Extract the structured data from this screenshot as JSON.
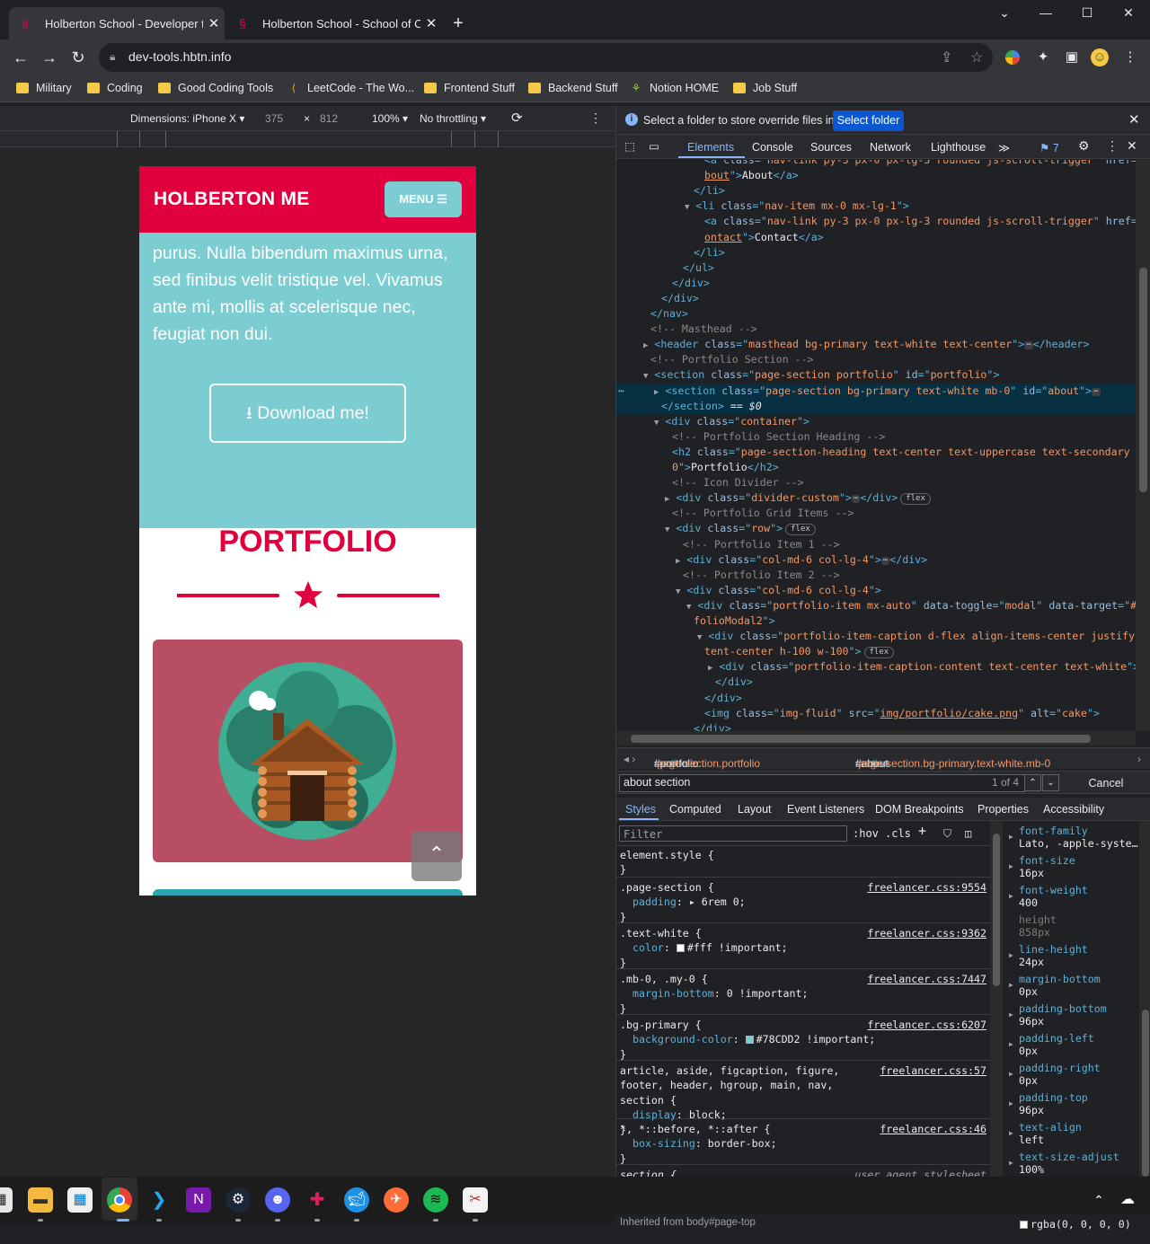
{
  "browser": {
    "tabs": [
      {
        "title": "Holberton School - Developer to"
      },
      {
        "title": "Holberton School - School of Co"
      }
    ],
    "new_tab": "+",
    "window_controls": {
      "chevron": "⌄",
      "minimize": "—",
      "maximize": "☐",
      "close": "✕"
    },
    "url": "dev-tools.hbtn.info",
    "bookmarks": [
      {
        "label": "Military",
        "icon": "folder-icon"
      },
      {
        "label": "Coding",
        "icon": "folder-icon"
      },
      {
        "label": "Good Coding Tools",
        "icon": "folder-icon"
      },
      {
        "label": "LeetCode - The Wo...",
        "icon": "leetcode-icon"
      },
      {
        "label": "Frontend Stuff",
        "icon": "folder-icon"
      },
      {
        "label": "Backend Stuff",
        "icon": "folder-icon"
      },
      {
        "label": "Notion HOME",
        "icon": "notion-icon"
      },
      {
        "label": "Job Stuff",
        "icon": "folder-icon"
      }
    ]
  },
  "device_toolbar": {
    "dimensions": "Dimensions: iPhone X ▾",
    "width": "375",
    "times": "×",
    "height": "812",
    "zoom": "100% ▾",
    "throttling": "No throttling ▾",
    "more": "⋮"
  },
  "page": {
    "brand": "HOLBERTON ME",
    "menu": "MENU ☰",
    "about_text": "purus. Nulla bibendum maximus urna, sed finibus velit tristique vel. Vivamus ante mi, mollis at scelerisque nec, feugiat non dui.",
    "download": "Download me!",
    "portfolio_heading": "PORTFOLIO",
    "back_to_top": "⌃"
  },
  "devtools": {
    "override_message": "Select a folder to store override files in.",
    "override_button": "Select folder",
    "tabs": [
      "Elements",
      "Console",
      "Sources",
      "Network",
      "Lighthouse"
    ],
    "tabs_more": "≫",
    "issues_count": "7",
    "breadcrumbs": [
      {
        "tag": "section",
        "rest": "#portfolio",
        "cls": ".page-section.portfolio"
      },
      {
        "tag": "section",
        "rest": "#about",
        "cls": ".page-section.bg-primary.text-white.mb-0"
      }
    ],
    "search": {
      "value": "about section",
      "count": "1 of 4",
      "up": "⌃",
      "down": "⌄",
      "cancel": "Cancel"
    },
    "styles_tabs": [
      "Styles",
      "Computed",
      "Layout",
      "Event Listeners",
      "DOM Breakpoints",
      "Properties",
      "Accessibility"
    ],
    "filter_placeholder": "Filter",
    "hov": ":hov",
    "cls": ".cls",
    "styles": [
      {
        "selector": "element.style {",
        "source": "",
        "props": []
      },
      {
        "selector": ".page-section {",
        "source": "freelancer.css:9554",
        "props": [
          {
            "name": "padding",
            "value": "▸ 6rem 0;"
          }
        ]
      },
      {
        "selector": ".text-white {",
        "source": "freelancer.css:9362",
        "props": [
          {
            "name": "color",
            "value": "#fff !important;",
            "swatch": "#ffffff"
          }
        ]
      },
      {
        "selector": ".mb-0, .my-0 {",
        "source": "freelancer.css:7447",
        "props": [
          {
            "name": "margin-bottom",
            "value": "0 !important;"
          }
        ]
      },
      {
        "selector": ".bg-primary {",
        "source": "freelancer.css:6207",
        "props": [
          {
            "name": "background-color",
            "value": "#78CDD2 !important;",
            "swatch": "#78CDD2"
          }
        ]
      },
      {
        "selector": "article, aside, figcaption, figure, footer, header, hgroup, main, nav, section {",
        "source": "freelancer.css:57",
        "props": [
          {
            "name": "display",
            "value": "block;"
          }
        ]
      },
      {
        "selector": "*, *::before, *::after {",
        "source": "freelancer.css:46",
        "props": [
          {
            "name": "box-sizing",
            "value": "border-box;"
          }
        ]
      },
      {
        "selector": "section {",
        "source": "user agent stylesheet",
        "props": []
      }
    ],
    "inherited": "Inherited from body#page-top",
    "computed": [
      {
        "name": "font-family",
        "value": "Lato, -apple-syste…"
      },
      {
        "name": "font-size",
        "value": "16px"
      },
      {
        "name": "font-weight",
        "value": "400"
      },
      {
        "name": "height",
        "value": "858px",
        "dim": true
      },
      {
        "name": "line-height",
        "value": "24px"
      },
      {
        "name": "margin-bottom",
        "value": "0px"
      },
      {
        "name": "padding-bottom",
        "value": "96px"
      },
      {
        "name": "padding-left",
        "value": "0px"
      },
      {
        "name": "padding-right",
        "value": "0px"
      },
      {
        "name": "padding-top",
        "value": "96px"
      },
      {
        "name": "text-align",
        "value": "left"
      },
      {
        "name": "text-size-adjust",
        "value": "100%"
      }
    ],
    "bottom_color": "rgba(0, 0, 0, 0)"
  },
  "taskbar": {
    "apps": [
      "file-explorer-icon",
      "microsoft-store-icon",
      "chrome-icon",
      "vscode-icon",
      "onenote-icon",
      "steam-icon",
      "discord-icon",
      "slack-icon",
      "docker-icon",
      "postman-icon",
      "spotify-icon",
      "snipping-tool-icon"
    ]
  }
}
